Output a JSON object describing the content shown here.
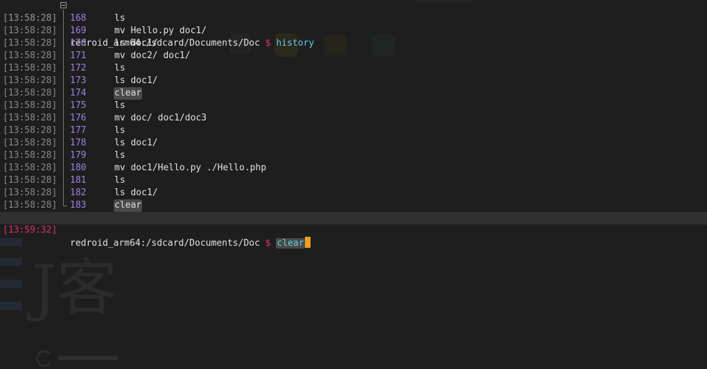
{
  "prompt": {
    "path": "redroid_arm64:/sdcard/Documents/Doc",
    "symbol": "$",
    "first_command": "history",
    "current_command": "clear",
    "first_timestamp": "[13:58:28]",
    "current_timestamp": "[13:59:32]"
  },
  "history": [
    {
      "ts": "[13:58:28]",
      "num": "168",
      "cmd": "ls"
    },
    {
      "ts": "[13:58:28]",
      "num": "169",
      "cmd": "mv Hello.py doc1/"
    },
    {
      "ts": "[13:58:28]",
      "num": "170",
      "cmd": "ls doc1/"
    },
    {
      "ts": "[13:58:28]",
      "num": "171",
      "cmd": "mv doc2/ doc1/"
    },
    {
      "ts": "[13:58:28]",
      "num": "172",
      "cmd": "ls"
    },
    {
      "ts": "[13:58:28]",
      "num": "173",
      "cmd": "ls doc1/"
    },
    {
      "ts": "[13:58:28]",
      "num": "174",
      "cmd": "clear",
      "highlight": true
    },
    {
      "ts": "[13:58:28]",
      "num": "175",
      "cmd": "ls"
    },
    {
      "ts": "[13:58:28]",
      "num": "176",
      "cmd": "mv doc/ doc1/doc3"
    },
    {
      "ts": "[13:58:28]",
      "num": "177",
      "cmd": "ls"
    },
    {
      "ts": "[13:58:28]",
      "num": "178",
      "cmd": "ls doc1/"
    },
    {
      "ts": "[13:58:28]",
      "num": "179",
      "cmd": "ls"
    },
    {
      "ts": "[13:58:28]",
      "num": "180",
      "cmd": "mv doc1/Hello.py ./Hello.php"
    },
    {
      "ts": "[13:58:28]",
      "num": "181",
      "cmd": "ls"
    },
    {
      "ts": "[13:58:28]",
      "num": "182",
      "cmd": "ls doc1/"
    },
    {
      "ts": "[13:58:28]",
      "num": "183",
      "cmd": "clear",
      "highlight": true
    }
  ],
  "colors": {
    "background": "#1e1e1e",
    "timestamp": "#8a8a8a",
    "timestamp_active": "#e0306f",
    "dollar": "#e0306f",
    "command_cyan": "#5fd0e6",
    "line_number": "#9f82e6",
    "cursor": "#f0a020"
  },
  "wallpaper_glyph": "J客"
}
